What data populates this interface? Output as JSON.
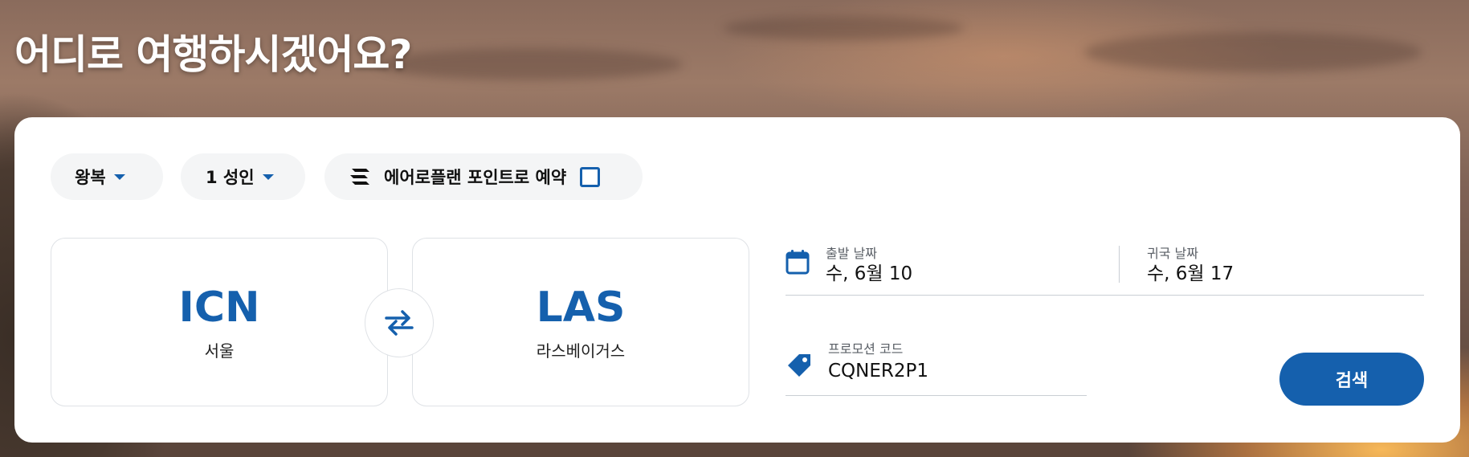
{
  "header": {
    "headline": "어디로 여행하시겠어요?"
  },
  "booking": {
    "trip_type": {
      "label": "왕복"
    },
    "passengers": {
      "label": "1 성인"
    },
    "points": {
      "label": "에어로플랜 포인트로 예약",
      "checked": false
    },
    "origin": {
      "code": "ICN",
      "city": "서울"
    },
    "destination": {
      "code": "LAS",
      "city": "라스베이거스"
    },
    "depart": {
      "label": "출발 날짜",
      "value": "수, 6월 10"
    },
    "return": {
      "label": "귀국 날짜",
      "value": "수, 6월 17"
    },
    "promo": {
      "label": "프로모션 코드",
      "value": "CQNER2P1"
    },
    "search_label": "검색"
  },
  "theme": {
    "accent": "#1560ad",
    "card_bg": "#ffffff",
    "pill_bg": "#f4f5f6"
  },
  "icons": [
    "chevron-down-icon",
    "aeroplan-logo-icon",
    "checkbox",
    "swap-arrows-icon",
    "calendar-icon",
    "tag-icon"
  ]
}
